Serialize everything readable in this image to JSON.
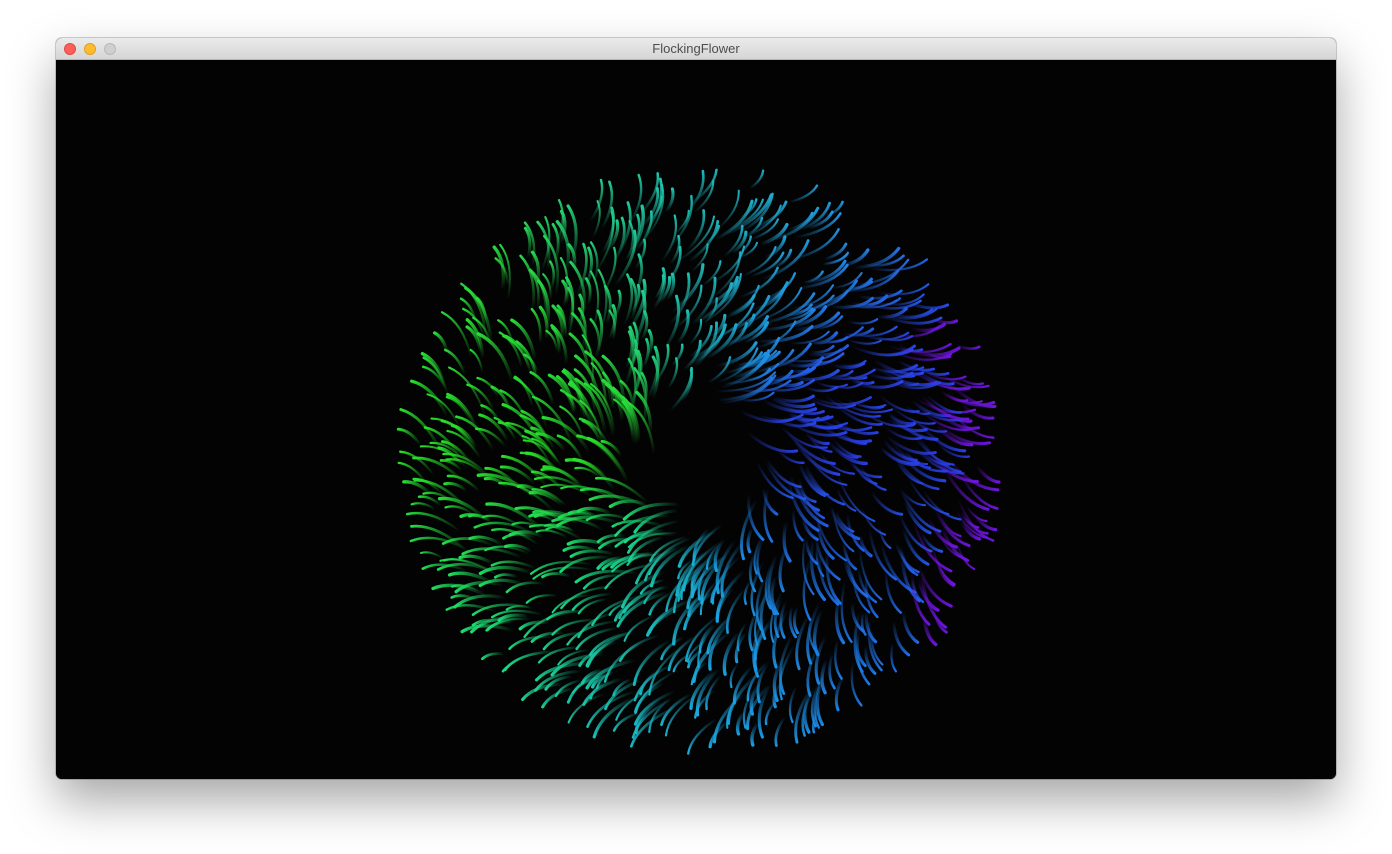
{
  "window": {
    "title": "FlockingFlower"
  },
  "controls": {
    "close_icon": "close-traffic-light",
    "minimize_icon": "minimize-traffic-light",
    "zoom_icon": "zoom-traffic-light"
  },
  "colors": {
    "background": "#030303",
    "gradient_start": "#22ee22",
    "gradient_mid": "#18b4e6",
    "gradient_end": "#7a10e8"
  }
}
